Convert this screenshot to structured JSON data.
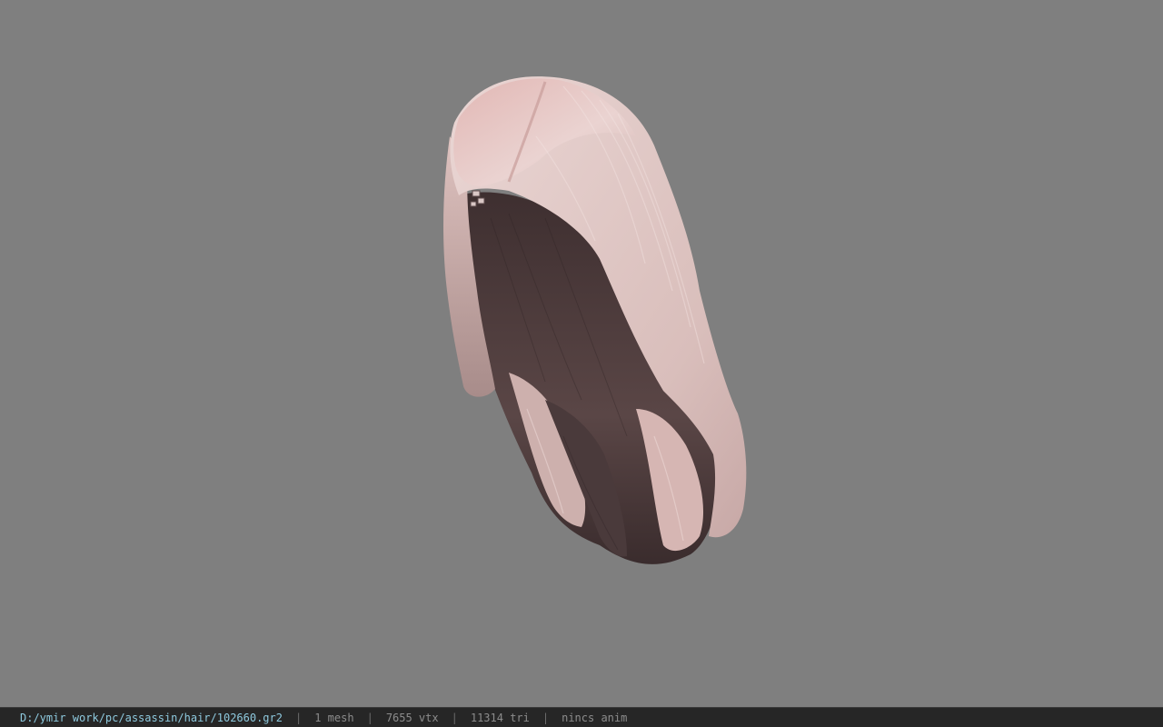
{
  "viewer": {
    "background_color": "#7f7f7f",
    "model_icon": "hair-model-icon",
    "hair_colors": {
      "light": "#e9cfcc",
      "mid": "#d4b0ae",
      "dark": "#4d3b3b"
    }
  },
  "status_bar": {
    "file_path": "D:/ymir work/pc/assassin/hair/102660.gr2",
    "separator": "|",
    "mesh_count": "1 mesh",
    "vertex_count": "7655 vtx",
    "triangle_count": "11314 tri",
    "animation": "nincs anim",
    "path_color": "#8ec9de",
    "text_color": "#8c8c8c"
  }
}
